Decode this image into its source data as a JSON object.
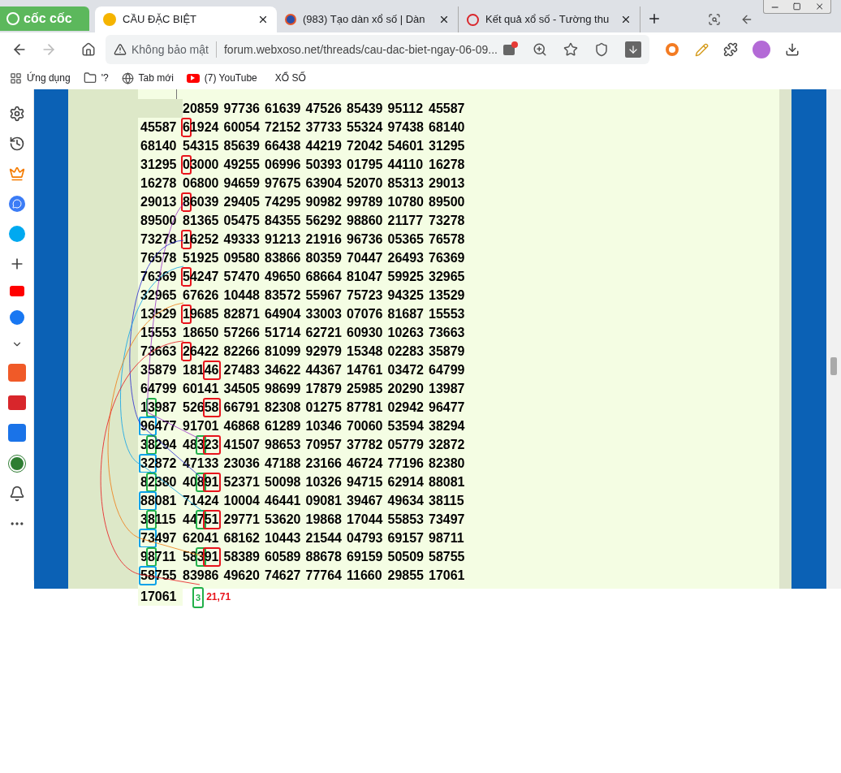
{
  "browser": {
    "brand": "cốc cốc",
    "tabs": [
      {
        "title": "CẦU ĐẶC BIỆT",
        "selected": true
      },
      {
        "title": "(983) Tạo dàn xổ số | Dàn",
        "selected": false
      },
      {
        "title": "Kết quả xổ số - Tường thu",
        "selected": false
      }
    ],
    "address": {
      "security": "Không bảo mật",
      "url": "forum.webxoso.net/threads/cau-dac-biet-ngay-06-09..."
    },
    "bookmarks": [
      {
        "kind": "apps",
        "label": "Ứng dụng"
      },
      {
        "kind": "folder",
        "label": "'?"
      },
      {
        "kind": "globe",
        "label": "Tab mới"
      },
      {
        "kind": "youtube",
        "label": "(7) YouTube"
      },
      {
        "kind": "ku",
        "label": "XỔ SỐ"
      }
    ]
  },
  "grid": {
    "rows": [
      {
        "cells": [
          "",
          "20859",
          "97736",
          "61639",
          "47526",
          "85439",
          "95112",
          "45587"
        ]
      },
      {
        "cells": [
          "45587",
          [
            {
              "text": "6",
              "color": "#e8141c"
            },
            {
              "text": "1924"
            }
          ],
          "60054",
          "72152",
          "37733",
          "55324",
          "97438",
          "68140"
        ]
      },
      {
        "cells": [
          "68140",
          "54315",
          "85639",
          "66438",
          "44219",
          "72042",
          "54601",
          "31295"
        ]
      },
      {
        "cells": [
          "31295",
          [
            {
              "text": "0",
              "color": "#e8141c"
            },
            {
              "text": "3000"
            }
          ],
          "49255",
          "06996",
          "50393",
          "01795",
          "44110",
          "16278"
        ]
      },
      {
        "cells": [
          "16278",
          "06800",
          "94659",
          "97675",
          "63904",
          "52070",
          "85313",
          "29013"
        ]
      },
      {
        "cells": [
          "29013",
          [
            {
              "text": "8",
              "color": "#e8141c"
            },
            {
              "text": "6039"
            }
          ],
          "29405",
          "74295",
          "90982",
          "99789",
          "10780",
          "89500"
        ]
      },
      {
        "cells": [
          "89500",
          "81365",
          "05475",
          "84355",
          "56292",
          "98860",
          "21177",
          "73278"
        ]
      },
      {
        "cells": [
          "73278",
          [
            {
              "text": "1",
              "color": "#e8141c"
            },
            {
              "text": "6252"
            }
          ],
          "49333",
          "91213",
          "21916",
          "96736",
          "05365",
          "76578"
        ]
      },
      {
        "cells": [
          "76578",
          "51925",
          "09580",
          "83866",
          "80359",
          "70447",
          "26493",
          "76369"
        ]
      },
      {
        "cells": [
          "76369",
          [
            {
              "text": "5",
              "color": "#e8141c"
            },
            {
              "text": "4247"
            }
          ],
          "57470",
          "49650",
          "68664",
          "81047",
          "59925",
          "32965"
        ]
      },
      {
        "cells": [
          "32965",
          "67626",
          "10448",
          "83572",
          "55967",
          "75723",
          "94325",
          "13529"
        ]
      },
      {
        "cells": [
          "13529",
          [
            {
              "text": "1",
              "color": "#e8141c"
            },
            {
              "text": "9685"
            }
          ],
          "82871",
          "64904",
          "33003",
          "07076",
          "81687",
          "15553"
        ]
      },
      {
        "cells": [
          "15553",
          "18650",
          "57266",
          "51714",
          "62721",
          "60930",
          "10263",
          "73663"
        ]
      },
      {
        "cells": [
          "73663",
          [
            {
              "text": "2",
              "color": "#e8141c"
            },
            {
              "text": "6422"
            }
          ],
          "82266",
          "81099",
          "92979",
          "15348",
          "02283",
          "35879"
        ]
      },
      {
        "cells": [
          "35879",
          [
            {
              "text": "181"
            },
            {
              "text": "46",
              "color": "#e8141c"
            }
          ],
          "27483",
          "34622",
          "44367",
          "14761",
          "03472",
          "64799"
        ]
      },
      {
        "cells": [
          "64799",
          "60141",
          "34505",
          "98699",
          "17879",
          "25985",
          "20290",
          "13987"
        ]
      },
      {
        "cells": [
          [
            {
              "text": "1"
            },
            {
              "text": "3",
              "color": "#22b04a"
            },
            {
              "text": "987"
            }
          ],
          [
            {
              "text": "526"
            },
            {
              "text": "58",
              "color": "#e8141c"
            }
          ],
          "66791",
          "82308",
          "01275",
          "87781",
          "02942",
          "96477"
        ]
      },
      {
        "cells": [
          [
            {
              "text": "96",
              "color": "#0aa2e8"
            },
            {
              "text": "477"
            }
          ],
          "91701",
          "46868",
          "61289",
          "10346",
          "70060",
          "53594",
          "38294"
        ]
      },
      {
        "cells": [
          [
            {
              "text": "3"
            },
            {
              "text": "8",
              "color": "#22b04a"
            },
            {
              "text": "294"
            }
          ],
          [
            {
              "text": "48"
            },
            {
              "text": "3",
              "color": "#22b04a"
            },
            {
              "text": "23",
              "color": "#e8141c"
            }
          ],
          "41507",
          "98653",
          "70957",
          "37782",
          "05779",
          "32872"
        ]
      },
      {
        "cells": [
          [
            {
              "text": "32",
              "color": "#0aa2e8"
            },
            {
              "text": "872"
            }
          ],
          "47133",
          "23036",
          "47188",
          "23166",
          "46724",
          "77196",
          "82380"
        ]
      },
      {
        "cells": [
          [
            {
              "text": "8"
            },
            {
              "text": "2",
              "color": "#22b04a"
            },
            {
              "text": "380"
            }
          ],
          [
            {
              "text": "40"
            },
            {
              "text": "8",
              "color": "#22b04a"
            },
            {
              "text": "91",
              "color": "#e8141c"
            }
          ],
          "52371",
          "50098",
          "10326",
          "94715",
          "62914",
          "88081"
        ]
      },
      {
        "cells": [
          [
            {
              "text": "88",
              "color": "#0aa2e8"
            },
            {
              "text": "081"
            }
          ],
          "71424",
          "10004",
          "46441",
          "09081",
          "39467",
          "49634",
          "38115"
        ]
      },
      {
        "cells": [
          [
            {
              "text": "3"
            },
            {
              "text": "8",
              "color": "#22b04a"
            },
            {
              "text": "115"
            }
          ],
          [
            {
              "text": "44"
            },
            {
              "text": "7",
              "color": "#22b04a"
            },
            {
              "text": "51",
              "color": "#e8141c"
            }
          ],
          "29771",
          "53620",
          "19868",
          "17044",
          "55853",
          "73497"
        ]
      },
      {
        "cells": [
          [
            {
              "text": "73",
              "color": "#0aa2e8"
            },
            {
              "text": "497"
            }
          ],
          "62041",
          "68162",
          "10443",
          "21544",
          "04793",
          "69157",
          "98711"
        ]
      },
      {
        "cells": [
          [
            {
              "text": "9"
            },
            {
              "text": "8",
              "color": "#22b04a"
            },
            {
              "text": "711"
            }
          ],
          [
            {
              "text": "58"
            },
            {
              "text": "3",
              "color": "#22b04a"
            },
            {
              "text": "91",
              "color": "#e8141c"
            }
          ],
          "58389",
          "60589",
          "88678",
          "69159",
          "50509",
          "58755"
        ]
      },
      {
        "cells": [
          [
            {
              "text": "58",
              "color": "#0aa2e8"
            },
            {
              "text": "755"
            }
          ],
          "83986",
          "49620",
          "74627",
          "77764",
          "11660",
          "29855",
          "17061"
        ]
      }
    ],
    "footer": {
      "last": "17061",
      "digit": "3",
      "pairs": "21,71"
    }
  }
}
